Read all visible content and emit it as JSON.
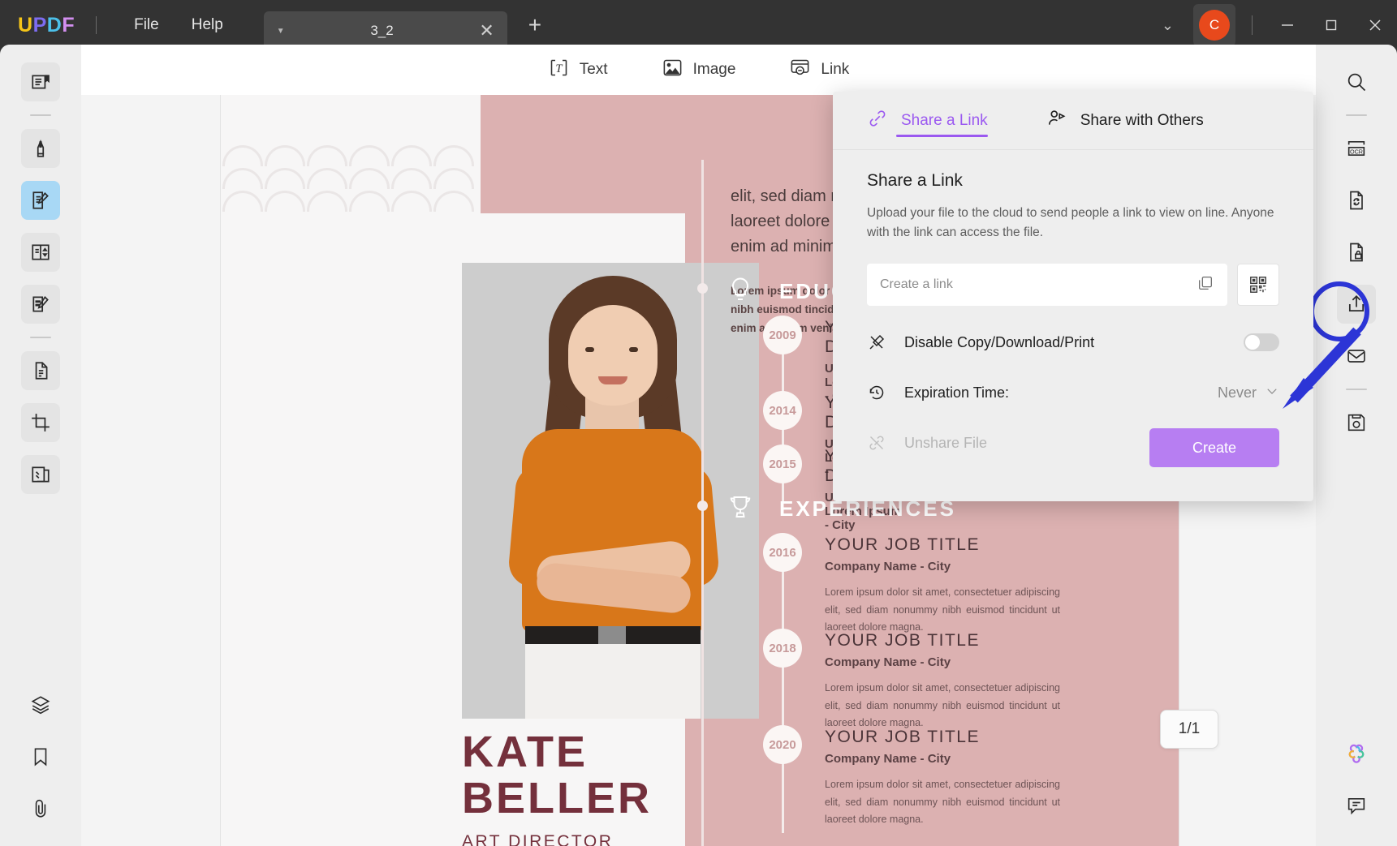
{
  "app": {
    "logo": "UPDF",
    "menus": [
      "File",
      "Help"
    ],
    "tab": {
      "title": "3_2",
      "caret": "dropdown-caret",
      "close": "close-icon"
    },
    "new_tab": "+",
    "account_initial": "C",
    "window_controls": [
      "minimize",
      "maximize",
      "close"
    ]
  },
  "doc_toolbar": {
    "items": [
      {
        "label": "Text",
        "icon": "text-icon"
      },
      {
        "label": "Image",
        "icon": "image-icon"
      },
      {
        "label": "Link",
        "icon": "link-icon"
      }
    ]
  },
  "left_sidebar": {
    "items": [
      {
        "name": "reader-icon",
        "state": "tint"
      },
      {
        "name": "separator"
      },
      {
        "name": "highlighter-icon",
        "state": "tint"
      },
      {
        "name": "edit-pdf-icon",
        "state": "active"
      },
      {
        "name": "page-organize-icon",
        "state": "tint"
      },
      {
        "name": "annotate-icon",
        "state": "tint"
      },
      {
        "name": "separator"
      },
      {
        "name": "convert-icon",
        "state": "tint"
      },
      {
        "name": "crop-icon",
        "state": "tint"
      },
      {
        "name": "compare-icon",
        "state": "tint"
      }
    ],
    "bottom_items": [
      {
        "name": "layers-icon"
      },
      {
        "name": "bookmark-icon"
      },
      {
        "name": "attachment-icon"
      }
    ]
  },
  "right_sidebar": {
    "items": [
      {
        "name": "search-icon"
      },
      {
        "name": "separator"
      },
      {
        "name": "ocr-icon"
      },
      {
        "name": "convert-file-icon"
      },
      {
        "name": "protect-icon"
      },
      {
        "name": "share-icon",
        "state": "selected"
      },
      {
        "name": "email-icon"
      },
      {
        "name": "separator"
      },
      {
        "name": "save-icon"
      }
    ],
    "bottom_items": [
      {
        "name": "ai-assistant-icon"
      },
      {
        "name": "comment-icon"
      }
    ]
  },
  "share_panel": {
    "tabs": [
      {
        "label": "Share a Link",
        "icon": "link-chain-icon",
        "active": true
      },
      {
        "label": "Share with Others",
        "icon": "share-people-icon",
        "active": false
      }
    ],
    "heading": "Share a Link",
    "description": "Upload your file to the cloud to send people a link to view on line. Anyone with the link can access the file.",
    "link_input": {
      "value": "",
      "placeholder": "Create a link"
    },
    "copy_icon": "copy-icon",
    "qr_icon": "qr-code-icon",
    "options": [
      {
        "label": "Disable Copy/Download/Print",
        "icon": "disable-copy-icon",
        "control": "toggle",
        "toggle_on": false,
        "disabled": false
      },
      {
        "label": "Expiration Time:",
        "icon": "history-clock-icon",
        "control": "select",
        "value": "Never",
        "disabled": false
      },
      {
        "label": "Unshare File",
        "icon": "unlink-icon",
        "control": "none",
        "disabled": true
      }
    ],
    "create_label": "Create",
    "accent_color": "#9b59f0",
    "button_color": "#b77ef2"
  },
  "document": {
    "page_indicator": "1/1",
    "name_first": "KATE",
    "name_last": "BELLER",
    "role": "ART DIRECTOR",
    "top_paragraph_large": "elit, sed diam non\nlaoreet dolore mag\nenim ad minim ven",
    "top_paragraph_small": "Lorem ipsum dolor sit ame\nnibh euismod tincidunt ut l\nenim ad minim veniam, qui",
    "sections": [
      {
        "title": "EDUCATION",
        "icon": "lightbulb-icon",
        "items": [
          {
            "year": "2009",
            "title": "YOUR DEGREE",
            "subtitle": "University of Lorem Ipsum - City"
          },
          {
            "year": "2014",
            "title": "YOUR DEGREE",
            "subtitle": "University of Lorem Ipsum - City"
          },
          {
            "year": "2015",
            "title": "YOUR DEGREE",
            "subtitle": "University of Lorem Ipsum - City"
          }
        ]
      },
      {
        "title": "EXPERIENCES",
        "icon": "trophy-icon",
        "items": [
          {
            "year": "2016",
            "title": "YOUR JOB TITLE",
            "subtitle": "Company Name - City",
            "description": "Lorem ipsum dolor sit amet, consectetuer adipiscing elit, sed diam nonummy nibh euismod tincidunt ut laoreet dolore magna."
          },
          {
            "year": "2018",
            "title": "YOUR JOB TITLE",
            "subtitle": "Company Name - City",
            "description": "Lorem ipsum dolor sit amet, consectetuer adipiscing elit, sed diam nonummy nibh euismod tincidunt ut laoreet dolore magna."
          },
          {
            "year": "2020",
            "title": "YOUR JOB TITLE",
            "subtitle": "Company Name - City",
            "description": "Lorem ipsum dolor sit amet, consectetuer adipiscing elit, sed diam nonummy nibh euismod tincidunt ut laoreet dolore magna."
          }
        ]
      }
    ],
    "colors": {
      "pink": "#dcb1b1",
      "maroon": "#74303c",
      "shirt": "#d8771a"
    }
  }
}
